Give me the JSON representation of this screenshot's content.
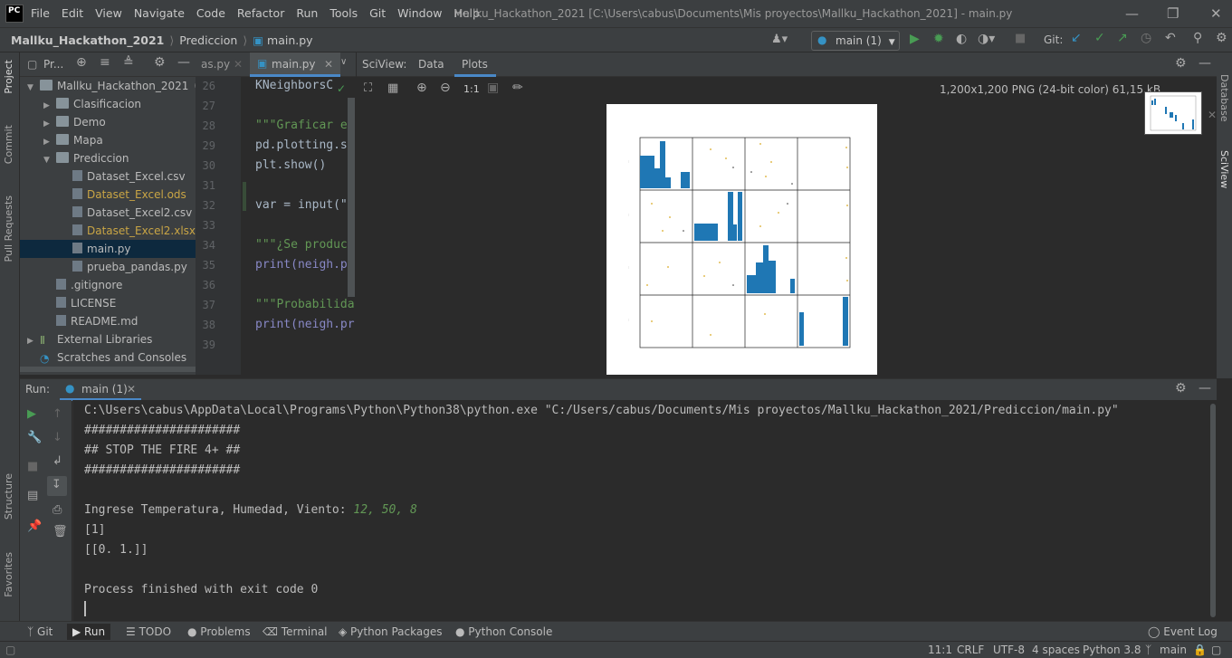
{
  "app": {
    "logo": "PC",
    "title": "Mallku_Hackathon_2021 [C:\\Users\\cabus\\Documents\\Mis proyectos\\Mallku_Hackathon_2021] - main.py"
  },
  "menu": [
    "File",
    "Edit",
    "View",
    "Navigate",
    "Code",
    "Refactor",
    "Run",
    "Tools",
    "Git",
    "Window",
    "Help"
  ],
  "breadcrumb": {
    "project": "Mallku_Hackathon_2021",
    "folder": "Prediccion",
    "file": "main.py"
  },
  "toolbar": {
    "run_config": "main (1)",
    "git_label": "Git:"
  },
  "project_panel": {
    "title": "Pr...",
    "tree": [
      {
        "label": "Mallku_Hackathon_2021",
        "suffix": "C:",
        "indent": 0,
        "type": "folder",
        "arrow": "down"
      },
      {
        "label": "Clasificacion",
        "indent": 1,
        "type": "folder",
        "arrow": "right"
      },
      {
        "label": "Demo",
        "indent": 1,
        "type": "folder",
        "arrow": "right"
      },
      {
        "label": "Mapa",
        "indent": 1,
        "type": "folder",
        "arrow": "right"
      },
      {
        "label": "Prediccion",
        "indent": 1,
        "type": "folder",
        "arrow": "down"
      },
      {
        "label": "Dataset_Excel.csv",
        "indent": 2,
        "type": "file"
      },
      {
        "label": "Dataset_Excel.ods",
        "indent": 2,
        "type": "file",
        "color": "yellow"
      },
      {
        "label": "Dataset_Excel2.csv",
        "indent": 2,
        "type": "file"
      },
      {
        "label": "Dataset_Excel2.xlsx",
        "indent": 2,
        "type": "file",
        "color": "yellow"
      },
      {
        "label": "main.py",
        "indent": 2,
        "type": "file",
        "selected": true
      },
      {
        "label": "prueba_pandas.py",
        "indent": 2,
        "type": "file"
      },
      {
        "label": ".gitignore",
        "indent": 1,
        "type": "file"
      },
      {
        "label": "LICENSE",
        "indent": 1,
        "type": "file"
      },
      {
        "label": "README.md",
        "indent": 1,
        "type": "file"
      },
      {
        "label": "External Libraries",
        "indent": 0,
        "type": "lib",
        "arrow": "right"
      },
      {
        "label": "Scratches and Consoles",
        "indent": 0,
        "type": "scratch"
      }
    ]
  },
  "editor": {
    "tabs": [
      "as.py",
      "main.py"
    ],
    "lines": [
      {
        "n": "26",
        "t": "KNeighborsC"
      },
      {
        "n": "27",
        "t": ""
      },
      {
        "n": "28",
        "t": "\"\"\"Graficar el"
      },
      {
        "n": "29",
        "t": "pd.plotting.sc"
      },
      {
        "n": "30",
        "t": "plt.show()"
      },
      {
        "n": "31",
        "t": ""
      },
      {
        "n": "32",
        "t": "var = input(\"I"
      },
      {
        "n": "33",
        "t": ""
      },
      {
        "n": "34",
        "t": "\"\"\"¿Se produce"
      },
      {
        "n": "35",
        "t": "print(neigh.pr"
      },
      {
        "n": "36",
        "t": ""
      },
      {
        "n": "37",
        "t": "\"\"\"Probabilida"
      },
      {
        "n": "38",
        "t": "print(neigh.pr"
      },
      {
        "n": "39",
        "t": ""
      }
    ]
  },
  "sciview": {
    "label": "SciView:",
    "tabs": [
      "Data",
      "Plots"
    ],
    "active_tab": "Plots",
    "zoom_label": "1:1",
    "image_info": "1,200x1,200 PNG (24-bit color) 61,15 kB"
  },
  "right_tabs": [
    "Database",
    "SciView"
  ],
  "left_tabs": [
    "Project",
    "Commit",
    "Pull Requests",
    "Structure",
    "Favorites"
  ],
  "run": {
    "label": "Run:",
    "tab": "main (1)",
    "output": [
      {
        "text": "C:\\Users\\cabus\\AppData\\Local\\Programs\\Python\\Python38\\python.exe \"C:/Users/cabus/Documents/Mis proyectos/Mallku_Hackathon_2021/Prediccion/main.py\""
      },
      {
        "text": "######################"
      },
      {
        "text": "## STOP THE FIRE 4+ ##"
      },
      {
        "text": "######################"
      },
      {
        "text": ""
      },
      {
        "text": "Ingrese Temperatura, Humedad, Viento: ",
        "input": "12, 50, 8"
      },
      {
        "text": "[1]"
      },
      {
        "text": "[[0. 1.]]"
      },
      {
        "text": ""
      },
      {
        "text": "Process finished with exit code 0"
      }
    ]
  },
  "bottom_tabs": [
    "Git",
    "Run",
    "TODO",
    "Problems",
    "Terminal",
    "Python Packages",
    "Python Console"
  ],
  "event_log": "Event Log",
  "status": {
    "position": "11:1",
    "line_sep": "CRLF",
    "encoding": "UTF-8",
    "indent": "4 spaces",
    "interpreter": "Python 3.8",
    "branch": "main"
  },
  "colors": {
    "accent": "#3592c4",
    "selection": "#0d293e",
    "run_green": "#499c54",
    "plot_bar": "#1f77b4"
  }
}
